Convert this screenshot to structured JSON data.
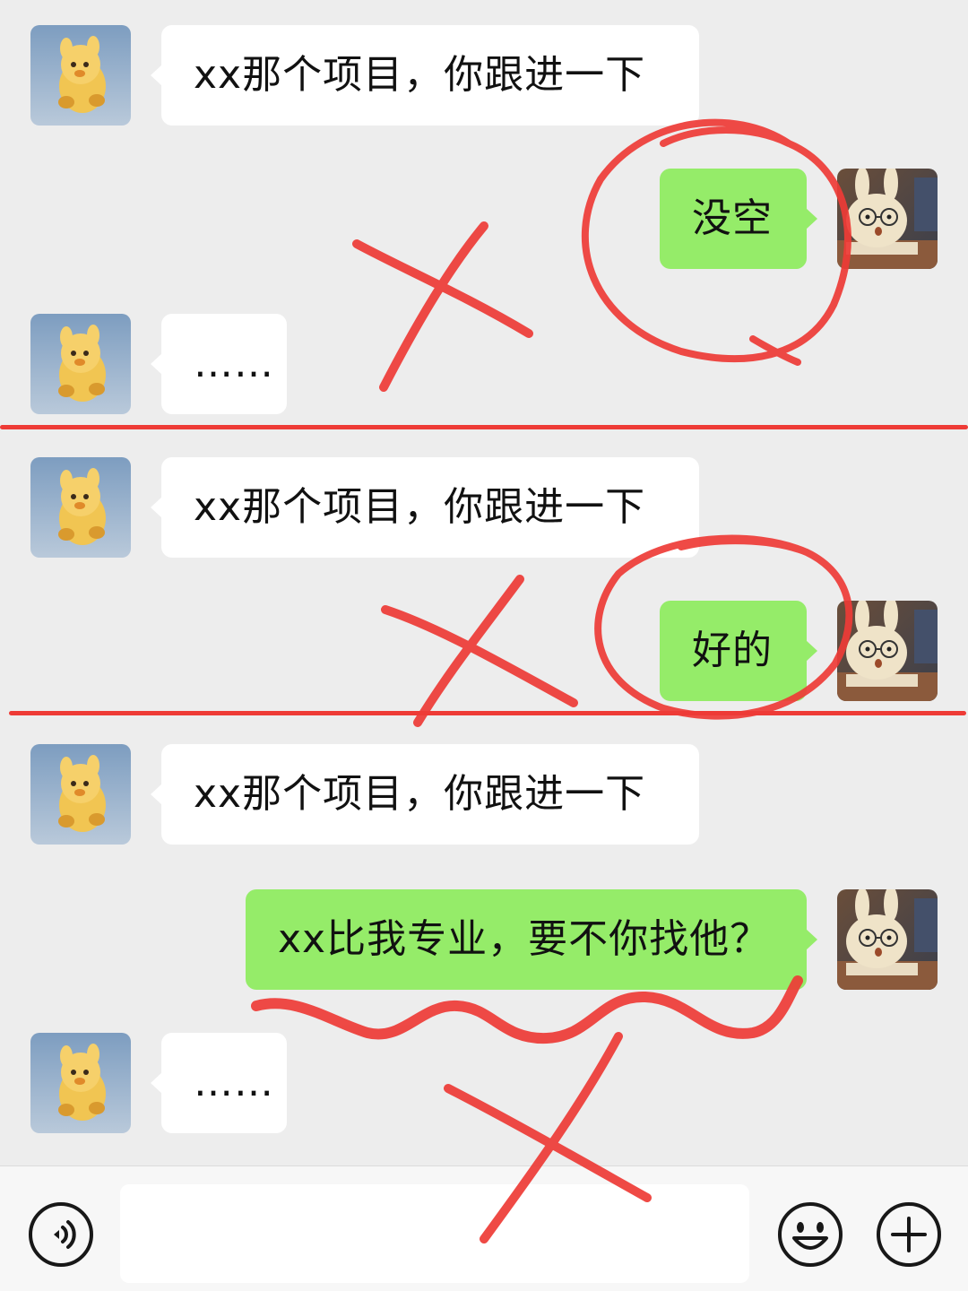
{
  "chat": {
    "messages": [
      {
        "side": "in",
        "text": "xx那个项目，你跟进一下",
        "avatar": "bear-plush-avatar"
      },
      {
        "side": "out",
        "text": "没空",
        "avatar": "bunny-glasses-avatar"
      },
      {
        "side": "in",
        "text": "……",
        "avatar": "bear-plush-avatar"
      },
      {
        "side": "in",
        "text": "xx那个项目，你跟进一下",
        "avatar": "bear-plush-avatar"
      },
      {
        "side": "out",
        "text": "好的",
        "avatar": "bunny-glasses-avatar"
      },
      {
        "side": "in",
        "text": "xx那个项目，你跟进一下",
        "avatar": "bear-plush-avatar"
      },
      {
        "side": "out",
        "text": "xx比我专业，要不你找他？",
        "avatar": "bunny-glasses-avatar"
      },
      {
        "side": "in",
        "text": "……",
        "avatar": "bear-plush-avatar"
      }
    ]
  },
  "annotations": {
    "color": "#ee3b36",
    "marks": [
      "x-mark",
      "circle-mark",
      "divider-line",
      "x-mark",
      "circle-mark",
      "divider-line",
      "wavy-underline",
      "x-mark"
    ]
  },
  "input_bar": {
    "voice_icon": "voice-icon",
    "emoji_icon": "emoji-icon",
    "plus_icon": "plus-icon",
    "input_value": ""
  },
  "colors": {
    "background": "#ededed",
    "incoming_bubble": "#ffffff",
    "outgoing_bubble": "#95ec69",
    "annotation_red": "#ee3b36"
  }
}
